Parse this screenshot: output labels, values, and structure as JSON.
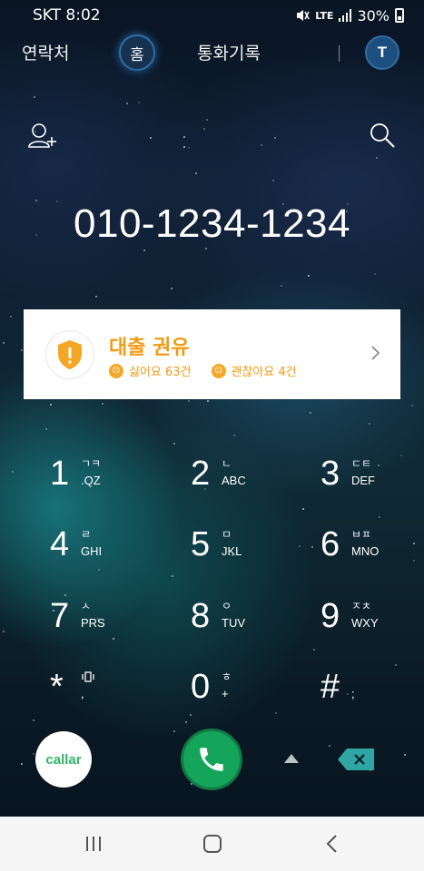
{
  "status_bar": {
    "carrier_time": "SKT 8:02",
    "network": "LTE",
    "battery": "30%"
  },
  "top_nav": {
    "tabs": [
      "연락처",
      "홈",
      "통화기록"
    ],
    "avatar_letter": "T"
  },
  "dialed_number": "010-1234-1234",
  "spam_card": {
    "title": "대출 권유",
    "dislike": "싫어요 63건",
    "like": "괜찮아요 4건",
    "colors": {
      "accent": "#f39a13"
    }
  },
  "dialpad": [
    {
      "digit": "1",
      "sub": "ㄱㅋ",
      "sub2": ".QZ"
    },
    {
      "digit": "2",
      "sub": "ㄴ",
      "sub2": "ABC"
    },
    {
      "digit": "3",
      "sub": "ㄷㅌ",
      "sub2": "DEF"
    },
    {
      "digit": "4",
      "sub": "ㄹ",
      "sub2": "GHI"
    },
    {
      "digit": "5",
      "sub": "ㅁ",
      "sub2": "JKL"
    },
    {
      "digit": "6",
      "sub": "ㅂㅍ",
      "sub2": "MNO"
    },
    {
      "digit": "7",
      "sub": "ㅅ",
      "sub2": "PRS"
    },
    {
      "digit": "8",
      "sub": "ㅇ",
      "sub2": "TUV"
    },
    {
      "digit": "9",
      "sub": "ㅈㅊ",
      "sub2": "WXY"
    },
    {
      "digit": "*",
      "sub": "",
      "sub2": ","
    },
    {
      "digit": "0",
      "sub": "ㅎ",
      "sub2": "+"
    },
    {
      "digit": "#",
      "sub": "",
      "sub2": ";"
    }
  ],
  "bottom": {
    "app_logo": "callar",
    "call_color": "#15a55a"
  }
}
